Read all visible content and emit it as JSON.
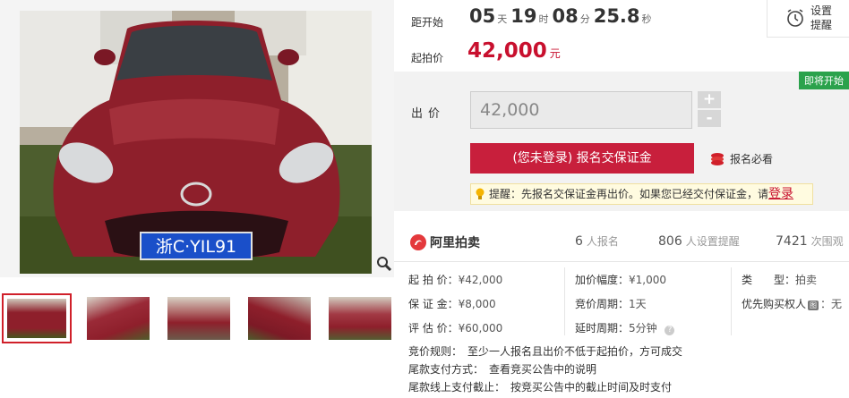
{
  "countdown": {
    "label": "距开始",
    "days": "05",
    "days_unit": "天",
    "hours": "19",
    "hours_unit": "时",
    "minutes": "08",
    "minutes_unit": "分",
    "seconds": "25.8",
    "seconds_unit": "秒"
  },
  "remind": {
    "line1": "设置",
    "line2": "提醒",
    "icon": "alarm-clock-icon"
  },
  "start_price": {
    "label": "起拍价",
    "value": "42,000",
    "unit": "元"
  },
  "bid": {
    "status_tag": "即将开始",
    "label": "出价",
    "input_value": "42,000",
    "plus": "+",
    "minus": "-",
    "deposit_button": "(您未登录) 报名交保证金",
    "must_read": "报名必看",
    "hint_prefix": "提醒：先报名交保证金再出价。如果您已经交付保证金，请",
    "hint_login": "登录"
  },
  "stats": {
    "brand": "阿里拍卖",
    "signups": "6",
    "signups_label": "人报名",
    "reminders": "806",
    "reminders_label": "人设置提醒",
    "views": "7421",
    "views_label": "次围观"
  },
  "attributes": {
    "start_price": {
      "k": "起 拍 价：",
      "v": "¥42,000"
    },
    "deposit": {
      "k": "保 证 金：",
      "v": "¥8,000"
    },
    "appraisal": {
      "k": "评 估 价：",
      "v": "¥60,000"
    },
    "increment": {
      "k": "加价幅度：",
      "v": "¥1,000"
    },
    "cycle": {
      "k": "竞价周期：",
      "v": "1天"
    },
    "delay": {
      "k": "延时周期：",
      "v": "5分钟"
    },
    "type": {
      "k": "类　　型：",
      "v": "拍卖"
    },
    "priority": {
      "k": "优先购买权人",
      "badge": "图",
      "v": "：无"
    }
  },
  "rules": [
    {
      "k": "竞价规则：",
      "v": "至少一人报名且出价不低于起拍价，方可成交"
    },
    {
      "k": "尾款支付方式：",
      "v": "查看竞买公告中的说明"
    },
    {
      "k": "尾款线上支付截止：",
      "v": "按竞买公告中的截止时间及时支付"
    }
  ],
  "photo": {
    "plate": "浙C·YIL91",
    "thumbnails": 5,
    "colors": {
      "body": "#8e1f2b",
      "accent": "#c8102e",
      "tag": "#2ba24c",
      "deposit": "#c81f3c"
    }
  }
}
